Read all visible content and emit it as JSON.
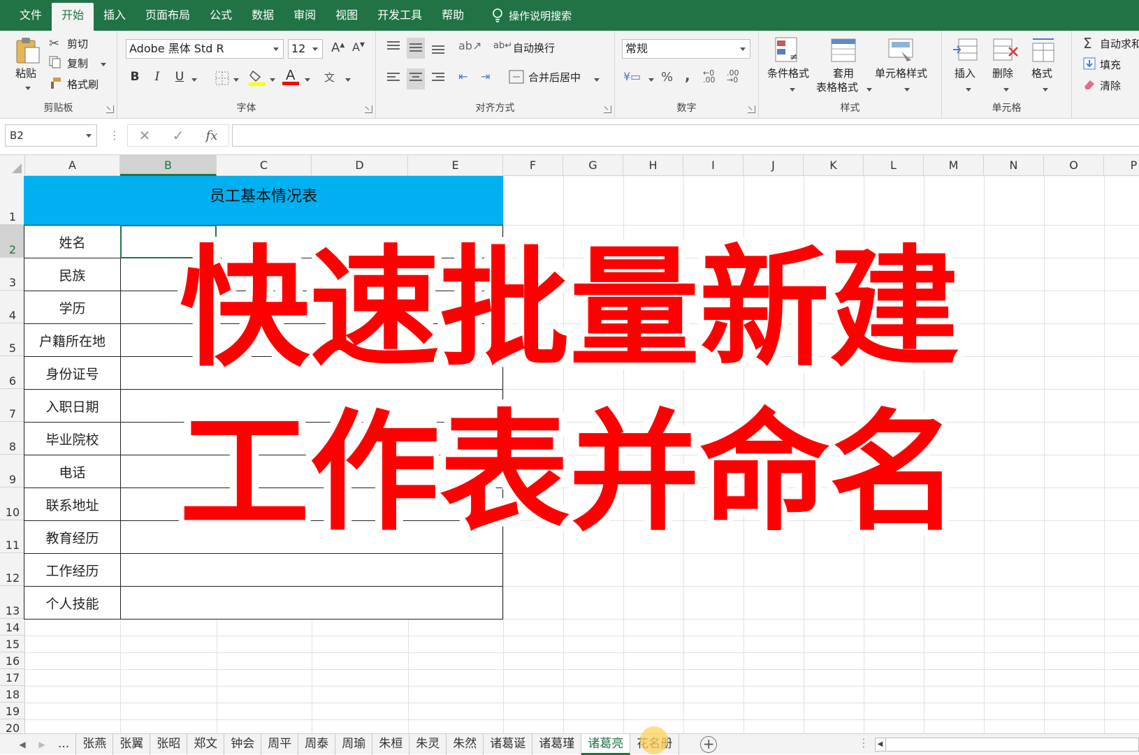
{
  "menu": {
    "tabs": [
      "文件",
      "开始",
      "插入",
      "页面布局",
      "公式",
      "数据",
      "审阅",
      "视图",
      "开发工具",
      "帮助"
    ],
    "active": "开始",
    "tell_me": "操作说明搜索"
  },
  "ribbon": {
    "clipboard": {
      "paste": "粘贴",
      "cut": "剪切",
      "copy": "复制",
      "format_painter": "格式刷",
      "label": "剪贴板"
    },
    "font": {
      "name": "Adobe 黑体 Std R",
      "size": "12",
      "bold": "B",
      "italic": "I",
      "underline": "U",
      "label": "字体"
    },
    "alignment": {
      "wrap": "自动换行",
      "merge": "合并后居中",
      "label": "对齐方式"
    },
    "number": {
      "format": "常规",
      "percent": "%",
      "comma": ",",
      "label": "数字"
    },
    "styles": {
      "conditional": "条件格式",
      "table_line1": "套用",
      "table_line2": "表格格式",
      "cell_styles": "单元格样式",
      "label": "样式"
    },
    "cells": {
      "insert": "插入",
      "delete": "删除",
      "format": "格式",
      "label": "单元格"
    },
    "editing": {
      "autosum": "自动求和",
      "fill": "填充",
      "clear": "清除"
    },
    "colors": {
      "fill_accent": "#ffff00",
      "font_accent": "#ff0000"
    }
  },
  "formula_bar": {
    "name_box": "B2",
    "fx": "fx",
    "value": ""
  },
  "columns": [
    "A",
    "B",
    "C",
    "D",
    "E",
    "F",
    "G",
    "H",
    "I",
    "J",
    "K",
    "L",
    "M",
    "N",
    "O",
    "P"
  ],
  "selected_column": "B",
  "rows": [
    "1",
    "2",
    "3",
    "4",
    "5",
    "6",
    "7",
    "8",
    "9",
    "10",
    "11",
    "12",
    "13",
    "14",
    "15",
    "16",
    "17",
    "18",
    "19",
    "20"
  ],
  "selected_row": "2",
  "table": {
    "title": "员工基本情况表",
    "title_color": "#00b0f0",
    "labels": [
      "姓名",
      "民族",
      "学历",
      "户籍所在地",
      "身份证号",
      "入职日期",
      "毕业院校",
      "电话",
      "联系地址",
      "教育经历",
      "工作经历",
      "个人技能"
    ]
  },
  "overlay": {
    "line1": "快速批量新建",
    "line2": "工作表并命名",
    "color": "#ff0000"
  },
  "sheet_tabs": {
    "ellipsis": "...",
    "tabs": [
      "张燕",
      "张翼",
      "张昭",
      "郑文",
      "钟会",
      "周平",
      "周泰",
      "周瑜",
      "朱桓",
      "朱灵",
      "朱然",
      "诸葛诞",
      "诸葛瑾",
      "诸葛亮",
      "花名册"
    ],
    "active": "诸葛亮",
    "add": "+"
  }
}
